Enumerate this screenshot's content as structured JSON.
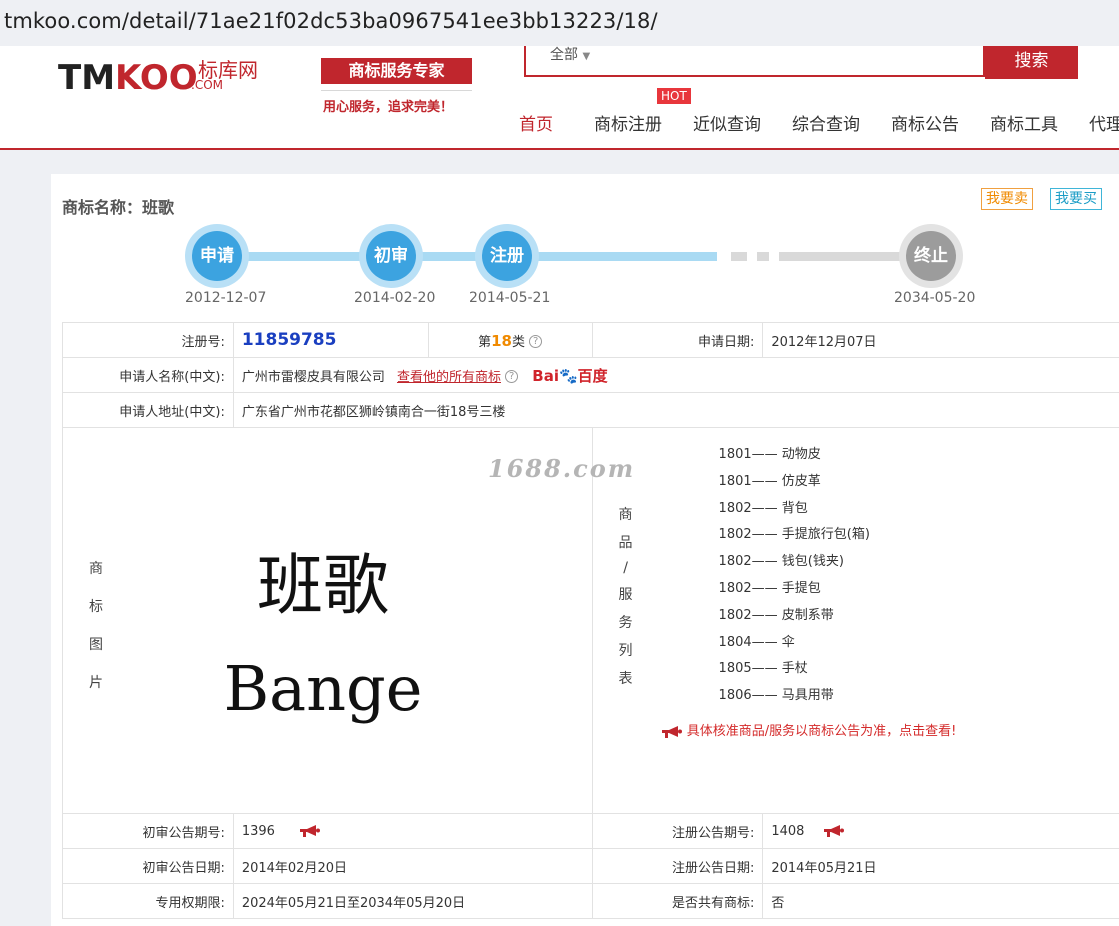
{
  "browser": {
    "url": "tmkoo.com/detail/71ae21f02dc53ba0967541ee3bb13223/18/"
  },
  "header": {
    "logo_main_tm": "TM",
    "logo_main_koo": "KOO",
    "logo_cn": "标库网",
    "logo_com": ".COM",
    "badge": "商标服务专家",
    "slogan": "用心服务，追求完美！",
    "search_scope": "全部",
    "search_button": "搜索",
    "hot_label": "HOT",
    "nav": [
      "首页",
      "商标注册",
      "近似查询",
      "综合查询",
      "商标公告",
      "商标工具",
      "代理"
    ],
    "accent": "#c0262d"
  },
  "card": {
    "title": "商标名称：班歌",
    "sell_button": "我要卖",
    "buy_button": "我要买",
    "timeline": [
      {
        "label": "申请",
        "date": "2012-12-07"
      },
      {
        "label": "初审",
        "date": "2014-02-20"
      },
      {
        "label": "注册",
        "date": "2014-05-21"
      },
      {
        "label": "终止",
        "date": "2034-05-20"
      }
    ],
    "rows": {
      "reg_no_label": "注册号:",
      "reg_no": "11859785",
      "class_prefix": "第",
      "class_no": "18",
      "class_suffix": "类",
      "apply_date_label": "申请日期:",
      "apply_date": "2012年12月07日",
      "applicant_label": "申请人名称(中文):",
      "applicant": "广州市雷樱皮具有限公司",
      "view_all_link": "查看他的所有商标",
      "baidu_bai": "Bai",
      "baidu_du": "百度",
      "address_label": "申请人地址(中文):",
      "address": "广东省广州市花都区狮岭镇南合一街18号三楼",
      "image_label_chars": [
        "商",
        "标",
        "图",
        "片"
      ],
      "mark_cn": "班歌",
      "mark_en": "Bange",
      "watermark": "1688.com",
      "goods_label_chars": [
        "商",
        "品",
        "/",
        "服",
        "务",
        "列",
        "表"
      ],
      "goods": [
        "1801—— 动物皮",
        "1801—— 仿皮革",
        "1802—— 背包",
        "1802—— 手提旅行包(箱)",
        "1802—— 钱包(钱夹)",
        "1802—— 手提包",
        "1802—— 皮制系带",
        "1804—— 伞",
        "1805—— 手杖",
        "1806—— 马具用带"
      ],
      "goods_notice": "具体核准商品/服务以商标公告为准，点击查看!",
      "prelim_no_label": "初审公告期号:",
      "prelim_no": "1396",
      "reg_notice_no_label": "注册公告期号:",
      "reg_notice_no": "1408",
      "prelim_date_label": "初审公告日期:",
      "prelim_date": "2014年02月20日",
      "reg_notice_date_label": "注册公告日期:",
      "reg_notice_date": "2014年05月21日",
      "exclusive_label": "专用权期限:",
      "exclusive": "2024年05月21日至2034年05月20日",
      "shared_label": "是否共有商标:",
      "shared": "否"
    }
  }
}
